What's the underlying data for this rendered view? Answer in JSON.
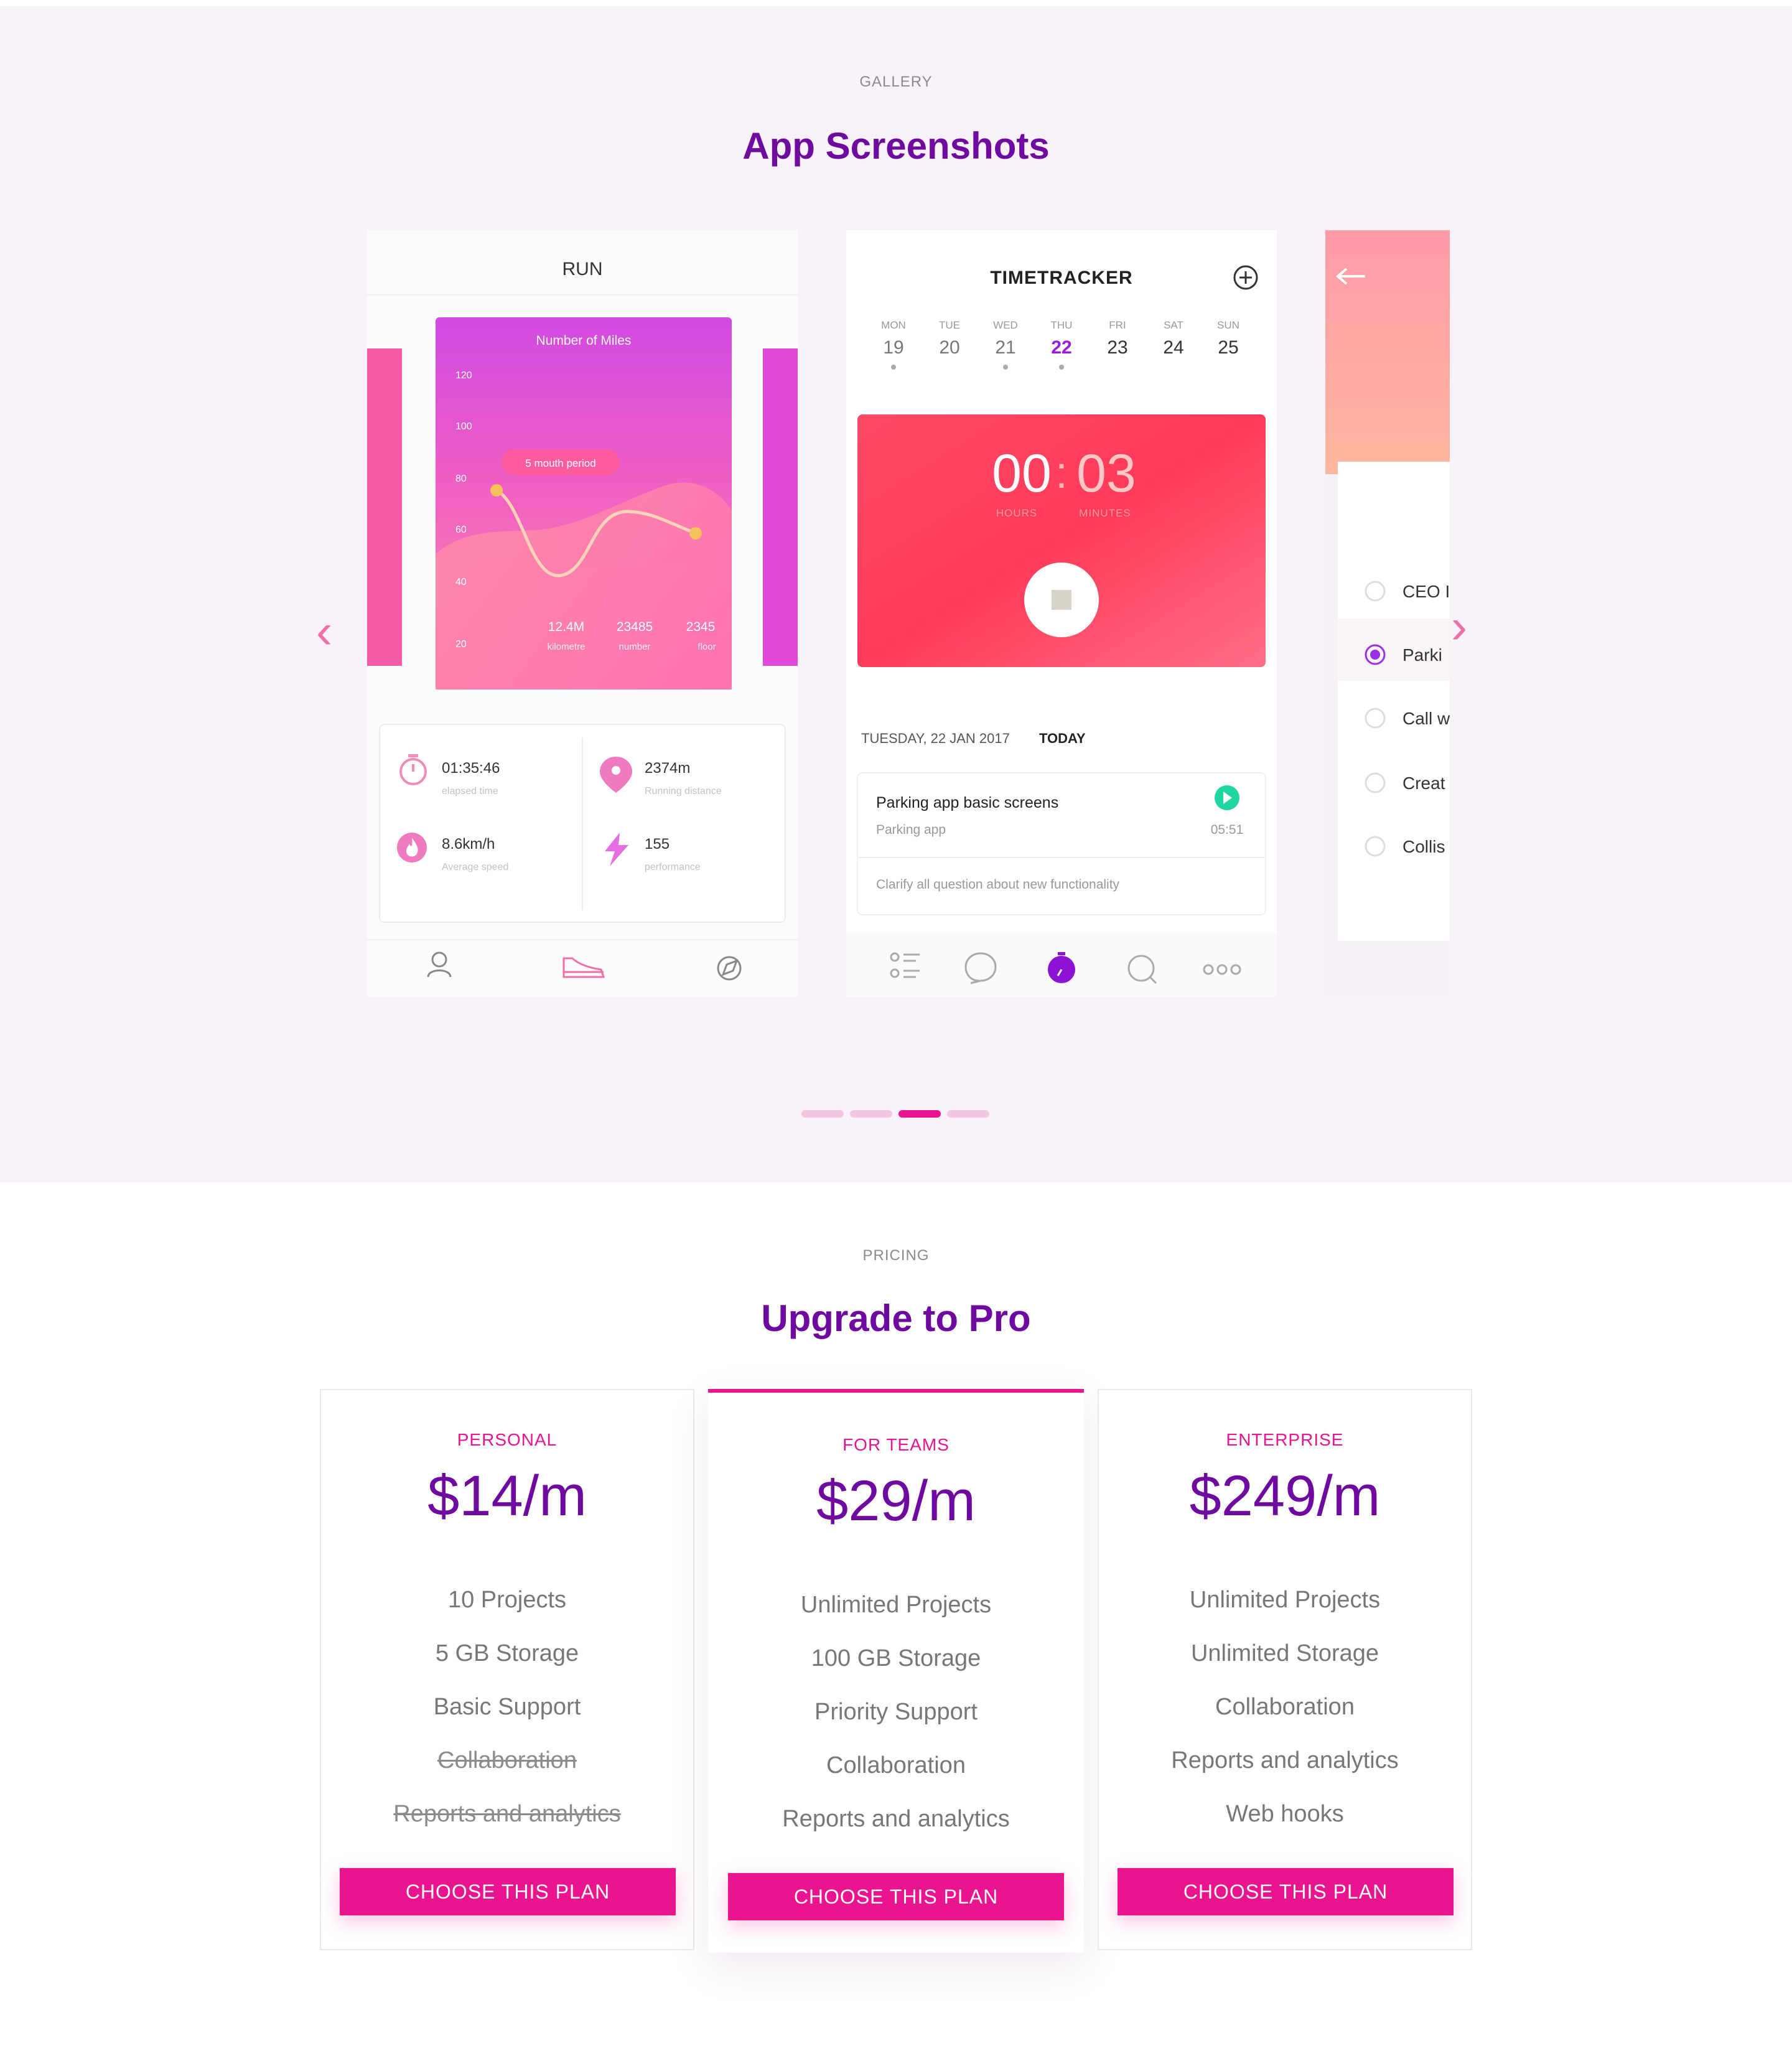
{
  "gallery": {
    "eyebrow": "GALLERY",
    "title": "App Screenshots",
    "active_dot": 3,
    "dot_count": 4
  },
  "run_app": {
    "title": "RUN",
    "chart_title": "Number of Miles",
    "chart_badge": "5 mouth period",
    "y_ticks": [
      "120",
      "100",
      "80",
      "60",
      "40",
      "20"
    ],
    "summary": [
      {
        "value": "12.4M",
        "label": "kilometre"
      },
      {
        "value": "23485",
        "label": "number"
      },
      {
        "value": "2345",
        "label": "floor"
      }
    ],
    "stats": [
      {
        "value": "01:35:46",
        "label": "elapsed time",
        "icon": "stopwatch-icon"
      },
      {
        "value": "2374m",
        "label": "Running distance",
        "icon": "location-pin-icon"
      },
      {
        "value": "8.6km/h",
        "label": "Average speed",
        "icon": "flame-icon"
      },
      {
        "value": "155",
        "label": "performance",
        "icon": "lightning-icon"
      }
    ]
  },
  "timetracker_app": {
    "title": "TIMETRACKER",
    "days": [
      {
        "name": "MON",
        "num": "19",
        "dot": true
      },
      {
        "name": "TUE",
        "num": "20",
        "dot": false
      },
      {
        "name": "WED",
        "num": "21",
        "dot": true
      },
      {
        "name": "THU",
        "num": "22",
        "dot": true,
        "active": true
      },
      {
        "name": "FRI",
        "num": "23",
        "dot": false
      },
      {
        "name": "SAT",
        "num": "24",
        "dot": false
      },
      {
        "name": "SUN",
        "num": "25",
        "dot": false
      }
    ],
    "timer_hours": "00",
    "timer_sep": ":",
    "timer_minutes": "03",
    "hours_label": "HOURS",
    "minutes_label": "MINUTES",
    "date_label": "TUESDAY, 22 JAN 2017",
    "today_label": "TODAY",
    "task_title": "Parking app basic screens",
    "task_project": "Parking app",
    "task_time": "05:51",
    "task_note": "Clarify all question about new functionality"
  },
  "third_app": {
    "items": [
      "CEO I",
      "Parki",
      "Call w",
      "Creat",
      "Collis"
    ],
    "selected_index": 1
  },
  "pricing": {
    "eyebrow": "PRICING",
    "title": "Upgrade to Pro",
    "plans": [
      {
        "name": "PERSONAL",
        "price": "$14/m",
        "features": [
          {
            "text": "10 Projects",
            "included": true
          },
          {
            "text": "5 GB Storage",
            "included": true
          },
          {
            "text": "Basic Support",
            "included": true
          },
          {
            "text": "Collaboration",
            "included": false
          },
          {
            "text": "Reports and analytics",
            "included": false
          }
        ],
        "cta": "CHOOSE THIS PLAN"
      },
      {
        "name": "FOR TEAMS",
        "price": "$29/m",
        "features": [
          {
            "text": "Unlimited Projects",
            "included": true
          },
          {
            "text": "100 GB Storage",
            "included": true
          },
          {
            "text": "Priority Support",
            "included": true
          },
          {
            "text": "Collaboration",
            "included": true
          },
          {
            "text": "Reports and analytics",
            "included": true
          }
        ],
        "cta": "CHOOSE THIS PLAN"
      },
      {
        "name": "ENTERPRISE",
        "price": "$249/m",
        "features": [
          {
            "text": "Unlimited Projects",
            "included": true
          },
          {
            "text": "Unlimited Storage",
            "included": true
          },
          {
            "text": "Collaboration",
            "included": true
          },
          {
            "text": "Reports and analytics",
            "included": true
          },
          {
            "text": "Web hooks",
            "included": true
          }
        ],
        "cta": "CHOOSE THIS PLAN"
      }
    ]
  },
  "colors": {
    "brand_purple": "#6f0aa0",
    "brand_pink": "#ea148f",
    "gallery_bg": "#faf2fa"
  }
}
